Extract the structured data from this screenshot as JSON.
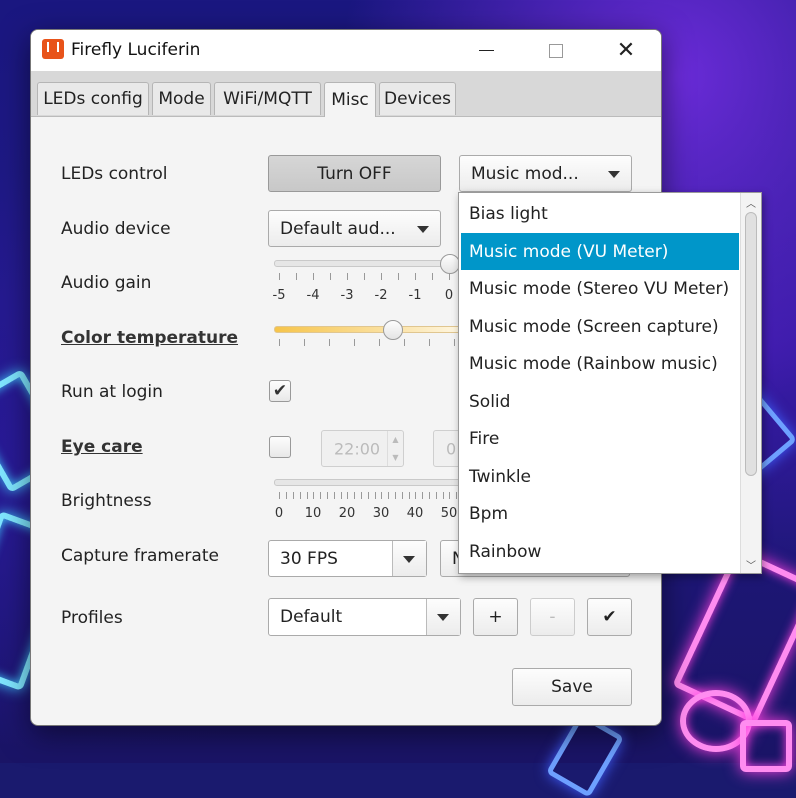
{
  "window": {
    "title": "Firefly Luciferin"
  },
  "tabs": [
    {
      "label": "LEDs config"
    },
    {
      "label": "Mode"
    },
    {
      "label": "WiFi/MQTT"
    },
    {
      "label": "Misc",
      "active": true
    },
    {
      "label": "Devices"
    }
  ],
  "leds_control": {
    "label": "LEDs control",
    "toggle_label": "Turn OFF",
    "effect_value": "Music mod..."
  },
  "audio_device": {
    "label": "Audio device",
    "value": "Default aud..."
  },
  "audio_gain": {
    "label": "Audio gain",
    "ticks": [
      "-5",
      "-4",
      "-3",
      "-2",
      "-1",
      "0"
    ],
    "value": 0
  },
  "color_temperature": {
    "label": "Color temperature"
  },
  "run_at_login": {
    "label": "Run at login",
    "checked": true,
    "check_glyph": "✔"
  },
  "eye_care": {
    "label": "Eye care",
    "checked": false,
    "from_time": "22:00",
    "to_time": "0"
  },
  "brightness": {
    "label": "Brightness",
    "ticks": [
      "0",
      "10",
      "20",
      "30",
      "40",
      "50"
    ]
  },
  "capture_framerate": {
    "label": "Capture framerate",
    "value": "30 FPS",
    "extra_value": "N"
  },
  "profiles": {
    "label": "Profiles",
    "value": "Default",
    "add_label": "+",
    "remove_label": "-",
    "apply_label": "✔"
  },
  "save_label": "Save",
  "effect_dropdown": {
    "items": [
      "Bias light",
      "Music mode (VU Meter)",
      "Music mode (Stereo VU Meter)",
      "Music mode (Screen capture)",
      "Music mode (Rainbow music)",
      "Solid",
      "Fire",
      "Twinkle",
      "Bpm",
      "Rainbow"
    ],
    "selected_index": 1
  },
  "colors": {
    "accent": "#0096c9",
    "app_icon": "#e8531a"
  }
}
